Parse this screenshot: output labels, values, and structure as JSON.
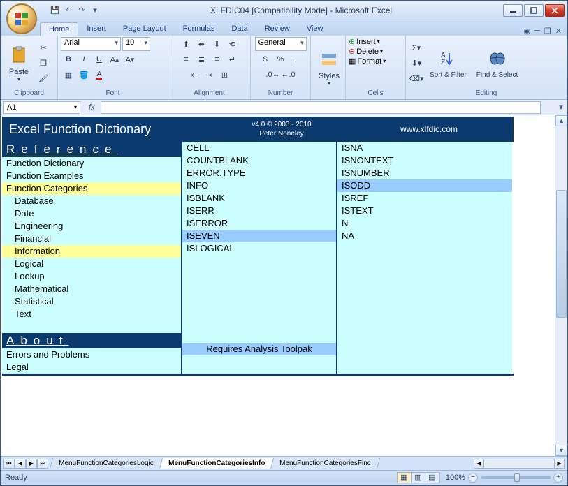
{
  "window": {
    "title": "XLFDIC04  [Compatibility Mode] - Microsoft Excel"
  },
  "ribbon": {
    "tabs": [
      "Home",
      "Insert",
      "Page Layout",
      "Formulas",
      "Data",
      "Review",
      "View"
    ],
    "active_tab": "Home",
    "groups": {
      "clipboard": "Clipboard",
      "font": "Font",
      "alignment": "Alignment",
      "number": "Number",
      "styles": "Styles",
      "cells": "Cells",
      "editing": "Editing"
    },
    "paste": "Paste",
    "font_name": "Arial",
    "font_size": "10",
    "number_format": "General",
    "styles_btn": "Styles",
    "insert": "Insert",
    "delete": "Delete",
    "format": "Format",
    "sort_filter": "Sort & Filter",
    "find_select": "Find & Select"
  },
  "formula_bar": {
    "name_box": "A1",
    "fx": "fx"
  },
  "dictionary": {
    "title": "Excel Function Dictionary",
    "version": "v4.0 © 2003 - 2010",
    "author": "Peter Noneley",
    "url": "www.xlfdic.com",
    "reference_hdr": "Reference",
    "about_hdr": "About",
    "col1_top": [
      {
        "text": "Function Dictionary",
        "cls": ""
      },
      {
        "text": "Function Examples",
        "cls": ""
      },
      {
        "text": "Function Categories",
        "cls": "hl-yellow"
      },
      {
        "text": "Database",
        "cls": "indent"
      },
      {
        "text": "Date",
        "cls": "indent"
      },
      {
        "text": "Engineering",
        "cls": "indent"
      },
      {
        "text": "Financial",
        "cls": "indent"
      },
      {
        "text": "Information",
        "cls": "indent hl-yellow"
      },
      {
        "text": "Logical",
        "cls": "indent"
      },
      {
        "text": "Lookup",
        "cls": "indent"
      },
      {
        "text": "Mathematical",
        "cls": "indent"
      },
      {
        "text": "Statistical",
        "cls": "indent"
      },
      {
        "text": "Text",
        "cls": "indent"
      }
    ],
    "col1_about": [
      {
        "text": "Errors and Problems",
        "cls": ""
      },
      {
        "text": "Legal",
        "cls": ""
      }
    ],
    "col2": [
      {
        "text": "CELL",
        "cls": ""
      },
      {
        "text": "COUNTBLANK",
        "cls": ""
      },
      {
        "text": "ERROR.TYPE",
        "cls": ""
      },
      {
        "text": "INFO",
        "cls": ""
      },
      {
        "text": "ISBLANK",
        "cls": ""
      },
      {
        "text": "ISERR",
        "cls": ""
      },
      {
        "text": "ISERROR",
        "cls": ""
      },
      {
        "text": "ISEVEN",
        "cls": "hl-blue"
      },
      {
        "text": "ISLOGICAL",
        "cls": ""
      }
    ],
    "col3": [
      {
        "text": "ISNA",
        "cls": ""
      },
      {
        "text": "ISNONTEXT",
        "cls": ""
      },
      {
        "text": "ISNUMBER",
        "cls": ""
      },
      {
        "text": "ISODD",
        "cls": "hl-blue"
      },
      {
        "text": "ISREF",
        "cls": ""
      },
      {
        "text": "ISTEXT",
        "cls": ""
      },
      {
        "text": "N",
        "cls": ""
      },
      {
        "text": "NA",
        "cls": ""
      }
    ],
    "toolpak": "Requires Analysis Toolpak"
  },
  "sheet_tabs": {
    "tabs": [
      "MenuFunctionCategoriesLogic",
      "MenuFunctionCategoriesInfo",
      "MenuFunctionCategoriesFinc"
    ],
    "active": 1
  },
  "status": {
    "text": "Ready",
    "zoom": "100%"
  }
}
